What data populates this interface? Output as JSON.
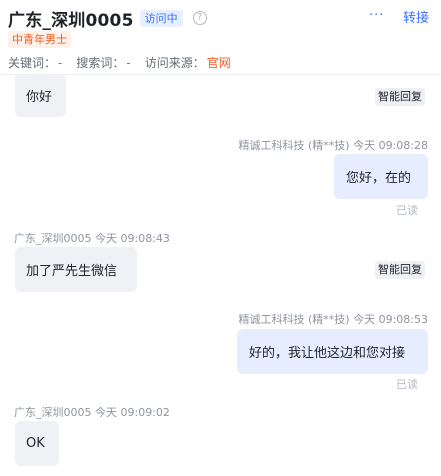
{
  "header": {
    "title": "广东_深圳0005",
    "status": "访问中",
    "help_glyph": "?",
    "more_glyph": "···",
    "transfer_label": "转接",
    "tag": "中青年男士",
    "meta": [
      {
        "label": "关键词：",
        "value": "-"
      },
      {
        "label": "搜索词：",
        "value": "-"
      },
      {
        "label": "访问来源：",
        "value": "官网"
      }
    ]
  },
  "messages": [
    {
      "dir": "in",
      "text": "你好",
      "smart_tag": "智能回复"
    },
    {
      "dir": "out",
      "sender": "精诚工科科技 (精**技) 今天 09:08:28",
      "text": "您好，在的",
      "read": "已读"
    },
    {
      "dir": "in",
      "sender": "广东_深圳0005 今天 09:08:43",
      "text": "加了严先生微信",
      "smart_tag": "智能回复"
    },
    {
      "dir": "out",
      "sender": "精诚工科科技 (精**技) 今天 09:08:53",
      "text": "好的，我让他这边和您对接",
      "read": "已读"
    },
    {
      "dir": "in",
      "sender": "广东_深圳0005 今天 09:09:02",
      "text": "OK"
    }
  ],
  "colors": {
    "accent": "#3370ff",
    "tag_orange": "#f05a26",
    "bubble_in": "#f0f1f5",
    "bubble_out": "#e5edff"
  },
  "icons": {
    "help": "question-circle-icon",
    "more": "ellipsis-icon"
  }
}
